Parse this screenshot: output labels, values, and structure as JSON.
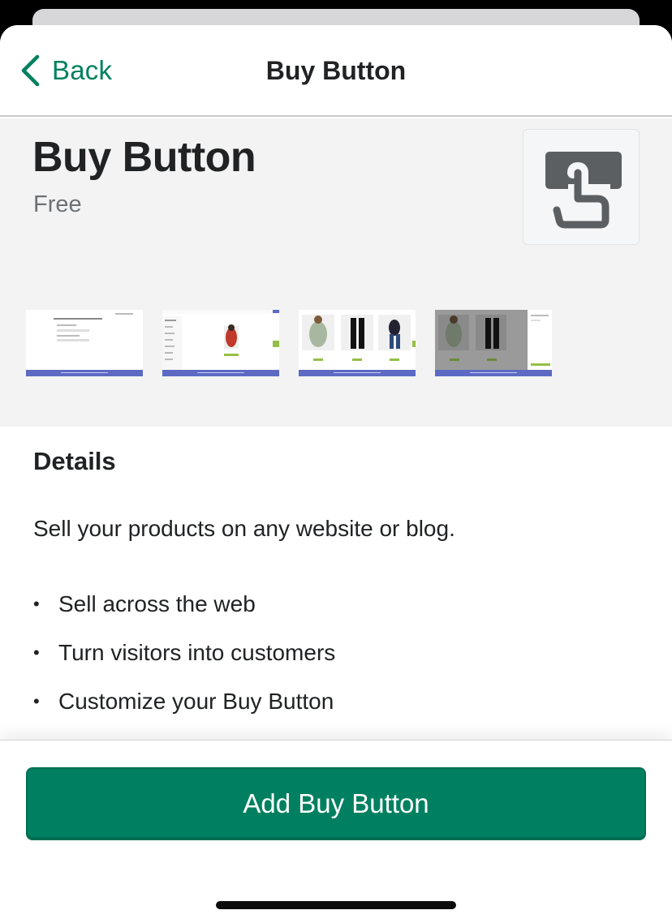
{
  "nav": {
    "back_label": "Back",
    "title": "Buy Button"
  },
  "app": {
    "name": "Buy Button",
    "price": "Free",
    "icon": "tap-finger-icon"
  },
  "screenshots": [
    {
      "name": "screenshot-1"
    },
    {
      "name": "screenshot-2"
    },
    {
      "name": "screenshot-3"
    },
    {
      "name": "screenshot-4"
    }
  ],
  "details": {
    "title": "Details",
    "description": "Sell your products on any website or blog.",
    "bullets": [
      "Sell across the web",
      "Turn visitors into customers",
      "Customize your Buy Button"
    ]
  },
  "cta": {
    "label": "Add Buy Button"
  },
  "colors": {
    "accent": "#008060",
    "hero_bg": "#f3f3f3",
    "screenshot_bar": "#5c6ac4"
  }
}
